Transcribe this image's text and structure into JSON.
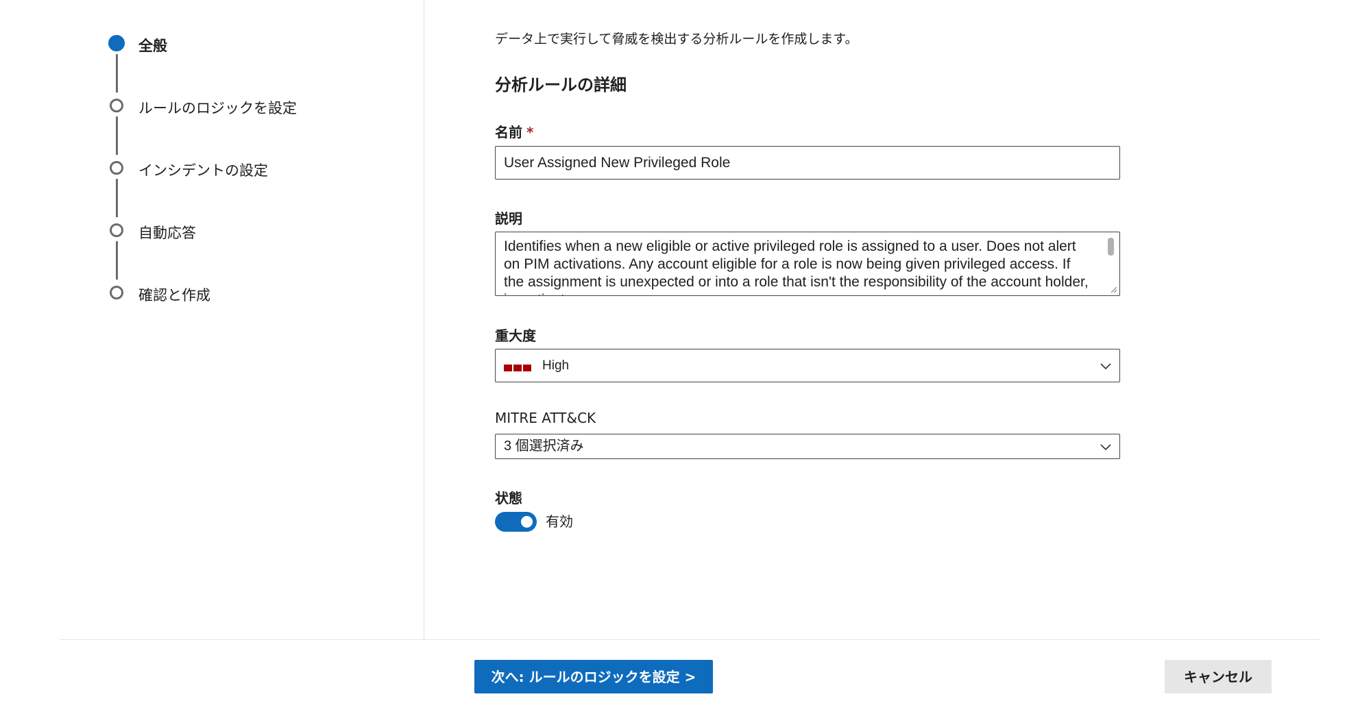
{
  "wizard": {
    "steps": [
      {
        "label": "全般",
        "active": true
      },
      {
        "label": "ルールのロジックを設定",
        "active": false
      },
      {
        "label": "インシデントの設定",
        "active": false
      },
      {
        "label": "自動応答",
        "active": false
      },
      {
        "label": "確認と作成",
        "active": false
      }
    ]
  },
  "form": {
    "intro": "データ上で実行して脅威を検出する分析ルールを作成します。",
    "section_title": "分析ルールの詳細",
    "name": {
      "label": "名前",
      "required_mark": "*",
      "value": "User Assigned New Privileged Role"
    },
    "description": {
      "label": "説明",
      "value": "Identifies when a new eligible or active privileged role is assigned to a user. Does not alert on PIM activations. Any account eligible for a role is now being given privileged access. If the assignment is unexpected or into a role that isn't the responsibility of the account holder, investigate."
    },
    "severity": {
      "label": "重大度",
      "value": "High",
      "color": "#a80000",
      "icon": "chevron-down-icon"
    },
    "mitre": {
      "label": "MITRE ATT&CK",
      "value": "3 個選択済み",
      "icon": "chevron-down-icon"
    },
    "status": {
      "label": "状態",
      "toggle_label": "有効",
      "enabled": true,
      "accent": "#0f6cbd"
    }
  },
  "footer": {
    "next_label": "次へ: ルールのロジックを設定 >",
    "cancel_label": "キャンセル"
  }
}
